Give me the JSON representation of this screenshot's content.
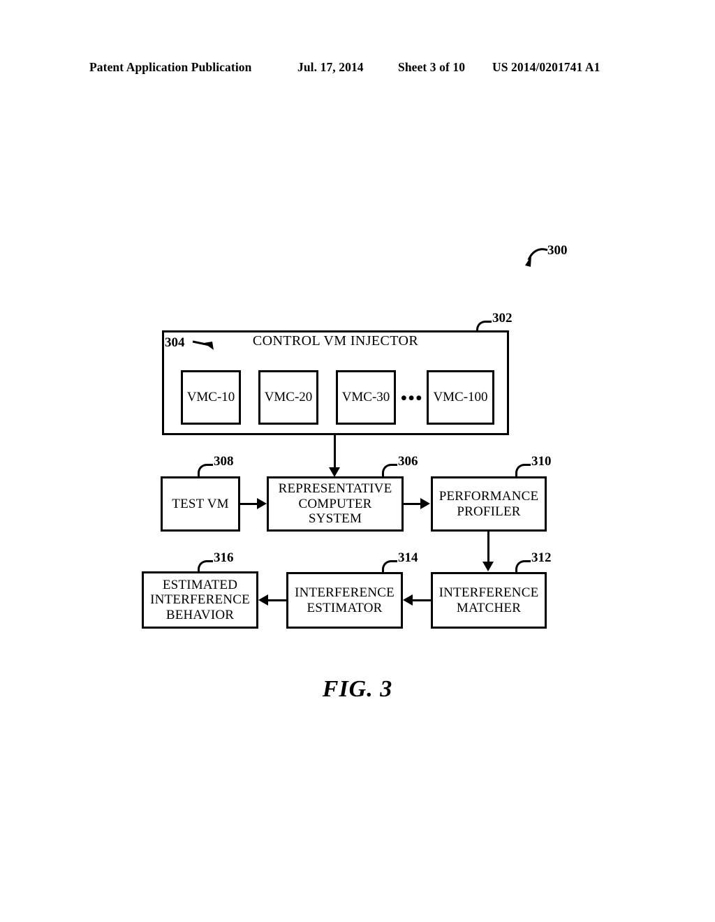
{
  "header": {
    "publication": "Patent Application Publication",
    "date": "Jul. 17, 2014",
    "sheet": "Sheet 3 of 10",
    "patent_number": "US 2014/0201741 A1"
  },
  "figure": {
    "caption": "FIG. 3",
    "system_ref": "300"
  },
  "diagram": {
    "injector": {
      "ref": "302",
      "title": "CONTROL VM INJECTOR",
      "vm_group_ref": "304",
      "vmcs": [
        {
          "label": "VMC-10"
        },
        {
          "label": "VMC-20"
        },
        {
          "label": "VMC-30"
        },
        {
          "label": "VMC-100"
        }
      ],
      "ellipsis": "•••"
    },
    "blocks": [
      {
        "ref": "308",
        "label": "TEST VM"
      },
      {
        "ref": "306",
        "label": "REPRESENTATIVE\nCOMPUTER SYSTEM"
      },
      {
        "ref": "310",
        "label": "PERFORMANCE\nPROFILER"
      },
      {
        "ref": "312",
        "label": "INTERFERENCE\nMATCHER"
      },
      {
        "ref": "314",
        "label": "INTERFERENCE\nESTIMATOR"
      },
      {
        "ref": "316",
        "label": "ESTIMATED\nINTERFERENCE\nBEHAVIOR"
      }
    ]
  },
  "colors": {
    "ink": "#000000",
    "paper": "#ffffff"
  }
}
